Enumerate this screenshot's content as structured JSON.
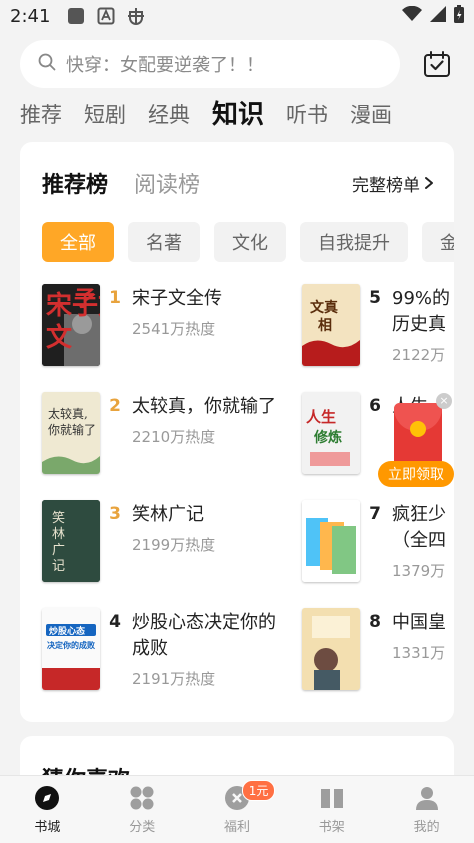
{
  "status_bar": {
    "time": "2:41"
  },
  "search": {
    "placeholder": "快穿：女配要逆袭了！！"
  },
  "top_tabs": [
    {
      "label": "推荐"
    },
    {
      "label": "短剧"
    },
    {
      "label": "经典"
    },
    {
      "label": "知识",
      "active": true
    },
    {
      "label": "听书"
    },
    {
      "label": "漫画"
    }
  ],
  "ranking": {
    "tabs": [
      {
        "label": "推荐榜",
        "active": true
      },
      {
        "label": "阅读榜"
      }
    ],
    "full_list_label": "完整榜单",
    "chips": [
      {
        "label": "全部",
        "active": true
      },
      {
        "label": "名著"
      },
      {
        "label": "文化"
      },
      {
        "label": "自我提升"
      },
      {
        "label": "金"
      }
    ],
    "books": [
      {
        "rank": "1",
        "title": "宋子文全传",
        "heat": "2541万热度",
        "cover_text": "宋子文"
      },
      {
        "rank": "2",
        "title": "太较真，你就输了",
        "heat": "2210万热度",
        "cover_text": "太较真,你就输了"
      },
      {
        "rank": "3",
        "title": "笑林广记",
        "heat": "2199万热度",
        "cover_text": "笑林广记"
      },
      {
        "rank": "4",
        "title": "炒股心态决定你的成败",
        "heat": "2191万热度",
        "cover_text": "炒股心态决定你的成败"
      },
      {
        "rank": "5",
        "title": "99%的历史真",
        "heat": "2122万",
        "cover_text": "文真相"
      },
      {
        "rank": "6",
        "title": "人生",
        "heat": "",
        "cover_text": "人生修炼"
      },
      {
        "rank": "7",
        "title": "疯狂少（全四",
        "heat": "1379万",
        "cover_text": ""
      },
      {
        "rank": "8",
        "title": "中国皇",
        "heat": "1331万",
        "cover_text": ""
      }
    ]
  },
  "float_redpack": {
    "button_label": "立即领取",
    "close": "×"
  },
  "guess": {
    "title": "猜你喜欢"
  },
  "bottom_nav": [
    {
      "label": "书城",
      "icon": "compass-icon",
      "active": true
    },
    {
      "label": "分类",
      "icon": "grid-icon"
    },
    {
      "label": "福利",
      "icon": "gift-icon",
      "badge": "1元"
    },
    {
      "label": "书架",
      "icon": "bookshelf-icon"
    },
    {
      "label": "我的",
      "icon": "person-icon"
    }
  ],
  "colors": {
    "accent": "#ffa726",
    "rank_top": "#e8a33d",
    "redpack": "#e53935"
  }
}
